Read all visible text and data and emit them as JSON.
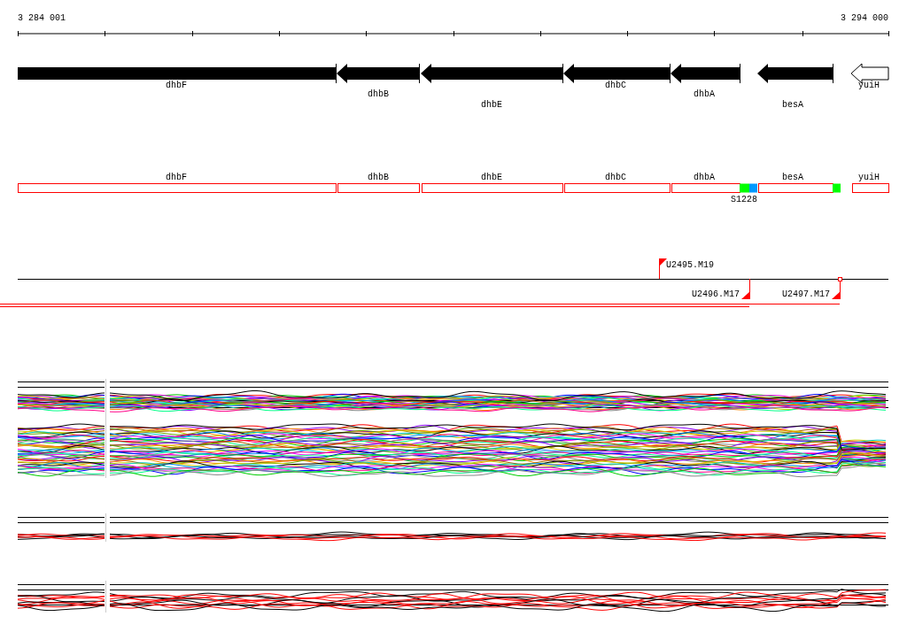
{
  "ruler": {
    "start_label": "3 284 001",
    "end_label": "3 294 000"
  },
  "genes": [
    {
      "name": "dhbF",
      "kind": "filled",
      "clipped": true
    },
    {
      "name": "dhbB",
      "kind": "filled",
      "clipped": false
    },
    {
      "name": "dhbE",
      "kind": "filled",
      "clipped": false
    },
    {
      "name": "dhbC",
      "kind": "filled",
      "clipped": false
    },
    {
      "name": "dhbA",
      "kind": "filled",
      "clipped": false
    },
    {
      "name": "besA",
      "kind": "filled",
      "clipped": false
    },
    {
      "name": "yuiH",
      "kind": "outline",
      "clipped": false
    }
  ],
  "annotation_track": {
    "boxes": [
      "dhbF",
      "dhbB",
      "dhbE",
      "dhbC",
      "dhbA",
      "besA",
      "yuiH"
    ],
    "features": [
      {
        "color": "#00ff00"
      },
      {
        "color": "#0099ff"
      },
      {
        "color": "#00ff00"
      }
    ],
    "feature_label": "S1228"
  },
  "markers": [
    {
      "label": "U2495.M19",
      "kind": "above"
    },
    {
      "label": "U2496.M17",
      "kind": "below"
    },
    {
      "label": "U2497.M17",
      "kind": "below-end"
    }
  ]
}
